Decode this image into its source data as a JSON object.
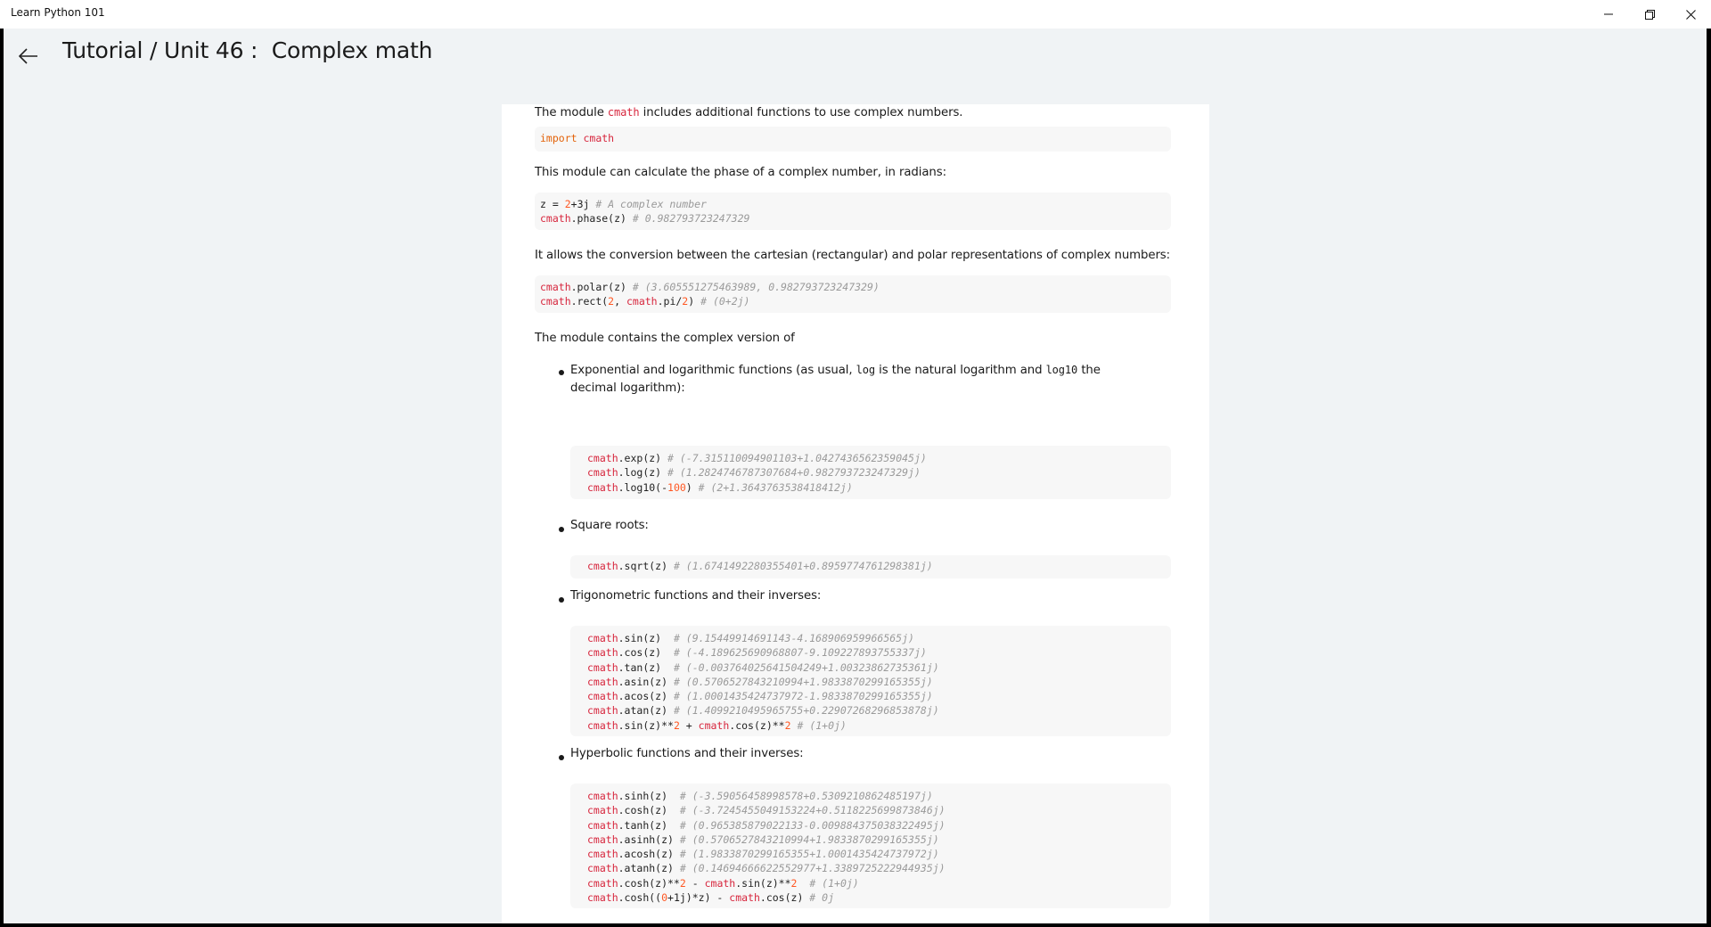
{
  "window": {
    "title": "Learn Python 101"
  },
  "header": {
    "title": "Tutorial / Unit 46 :  Complex math"
  },
  "colors": {
    "keyword": "#e36209",
    "module": "#d7263d",
    "number": "#ff5722",
    "comment": "#9a9a9a",
    "app_background": "#f0f3f5"
  },
  "content": {
    "intro": {
      "before": "The module ",
      "code": "cmath",
      "after": " includes additional functions to use complex numbers."
    },
    "phase_text": "This module can calculate the phase of a complex number, in radians:",
    "polar_text": "It allows the conversion between the cartesian (rectangular) and polar representations of complex numbers:",
    "contains_text": "The module contains the complex version of",
    "bullet_exp": {
      "t1": "Exponential and logarithmic functions (as usual, ",
      "c1": "log",
      "t2": " is the natural logarithm and ",
      "c2": "log10",
      "t3": " the decimal logarithm):"
    },
    "bullet_sqrt": "Square roots:",
    "bullet_trig": "Trigonometric functions and their inverses:",
    "bullet_hyp": "Hyperbolic functions and their inverses:"
  },
  "code_blocks": [
    [
      [
        [
          "kw",
          "import"
        ],
        [
          "tx",
          " "
        ],
        [
          "mod",
          "cmath"
        ]
      ]
    ],
    [
      [
        [
          "tx",
          "z = "
        ],
        [
          "num",
          "2"
        ],
        [
          "tx",
          "+3j "
        ],
        [
          "cm",
          "# A complex number"
        ]
      ],
      [
        [
          "mod",
          "cmath"
        ],
        [
          "tx",
          ".phase(z) "
        ],
        [
          "cm",
          "# 0.982793723247329"
        ]
      ]
    ],
    [
      [
        [
          "mod",
          "cmath"
        ],
        [
          "tx",
          ".polar(z) "
        ],
        [
          "cm",
          "# (3.605551275463989, 0.982793723247329)"
        ]
      ],
      [
        [
          "mod",
          "cmath"
        ],
        [
          "tx",
          ".rect("
        ],
        [
          "num",
          "2"
        ],
        [
          "tx",
          ", "
        ],
        [
          "mod",
          "cmath"
        ],
        [
          "tx",
          ".pi/"
        ],
        [
          "num",
          "2"
        ],
        [
          "tx",
          ") "
        ],
        [
          "cm",
          "# (0+2j)"
        ]
      ]
    ],
    [
      [
        [
          "mod",
          "cmath"
        ],
        [
          "tx",
          ".exp(z) "
        ],
        [
          "cm",
          "# (-7.315110094901103+1.0427436562359045j)"
        ]
      ],
      [
        [
          "mod",
          "cmath"
        ],
        [
          "tx",
          ".log(z) "
        ],
        [
          "cm",
          "# (1.2824746787307684+0.982793723247329j)"
        ]
      ],
      [
        [
          "mod",
          "cmath"
        ],
        [
          "tx",
          ".log10(-"
        ],
        [
          "num",
          "100"
        ],
        [
          "tx",
          ") "
        ],
        [
          "cm",
          "# (2+1.3643763538418412j)"
        ]
      ]
    ],
    [
      [
        [
          "mod",
          "cmath"
        ],
        [
          "tx",
          ".sqrt(z) "
        ],
        [
          "cm",
          "# (1.6741492280355401+0.8959774761298381j)"
        ]
      ]
    ],
    [
      [
        [
          "mod",
          "cmath"
        ],
        [
          "tx",
          ".sin(z)  "
        ],
        [
          "cm",
          "# (9.15449914691143-4.168906959966565j)"
        ]
      ],
      [
        [
          "mod",
          "cmath"
        ],
        [
          "tx",
          ".cos(z)  "
        ],
        [
          "cm",
          "# (-4.189625690968807-9.109227893755337j)"
        ]
      ],
      [
        [
          "mod",
          "cmath"
        ],
        [
          "tx",
          ".tan(z)  "
        ],
        [
          "cm",
          "# (-0.003764025641504249+1.00323862735361j)"
        ]
      ],
      [
        [
          "mod",
          "cmath"
        ],
        [
          "tx",
          ".asin(z) "
        ],
        [
          "cm",
          "# (0.5706527843210994+1.9833870299165355j)"
        ]
      ],
      [
        [
          "mod",
          "cmath"
        ],
        [
          "tx",
          ".acos(z) "
        ],
        [
          "cm",
          "# (1.0001435424737972-1.9833870299165355j)"
        ]
      ],
      [
        [
          "mod",
          "cmath"
        ],
        [
          "tx",
          ".atan(z) "
        ],
        [
          "cm",
          "# (1.4099210495965755+0.22907268296853878j)"
        ]
      ],
      [
        [
          "mod",
          "cmath"
        ],
        [
          "tx",
          ".sin(z)**"
        ],
        [
          "num",
          "2"
        ],
        [
          "tx",
          " + "
        ],
        [
          "mod",
          "cmath"
        ],
        [
          "tx",
          ".cos(z)**"
        ],
        [
          "num",
          "2"
        ],
        [
          "tx",
          " "
        ],
        [
          "cm",
          "# (1+0j)"
        ]
      ]
    ],
    [
      [
        [
          "mod",
          "cmath"
        ],
        [
          "tx",
          ".sinh(z)  "
        ],
        [
          "cm",
          "# (-3.59056458998578+0.5309210862485197j)"
        ]
      ],
      [
        [
          "mod",
          "cmath"
        ],
        [
          "tx",
          ".cosh(z)  "
        ],
        [
          "cm",
          "# (-3.7245455049153224+0.5118225699873846j)"
        ]
      ],
      [
        [
          "mod",
          "cmath"
        ],
        [
          "tx",
          ".tanh(z)  "
        ],
        [
          "cm",
          "# (0.965385879022133-0.009884375038322495j)"
        ]
      ],
      [
        [
          "mod",
          "cmath"
        ],
        [
          "tx",
          ".asinh(z) "
        ],
        [
          "cm",
          "# (0.5706527843210994+1.9833870299165355j)"
        ]
      ],
      [
        [
          "mod",
          "cmath"
        ],
        [
          "tx",
          ".acosh(z) "
        ],
        [
          "cm",
          "# (1.9833870299165355+1.0001435424737972j)"
        ]
      ],
      [
        [
          "mod",
          "cmath"
        ],
        [
          "tx",
          ".atanh(z) "
        ],
        [
          "cm",
          "# (0.14694666622552977+1.3389725222944935j)"
        ]
      ],
      [
        [
          "mod",
          "cmath"
        ],
        [
          "tx",
          ".cosh(z)**"
        ],
        [
          "num",
          "2"
        ],
        [
          "tx",
          " - "
        ],
        [
          "mod",
          "cmath"
        ],
        [
          "tx",
          ".sin(z)**"
        ],
        [
          "num",
          "2"
        ],
        [
          "tx",
          "  "
        ],
        [
          "cm",
          "# (1+0j)"
        ]
      ],
      [
        [
          "mod",
          "cmath"
        ],
        [
          "tx",
          ".cosh(("
        ],
        [
          "num",
          "0"
        ],
        [
          "tx",
          "+1j)*z) - "
        ],
        [
          "mod",
          "cmath"
        ],
        [
          "tx",
          ".cos(z) "
        ],
        [
          "cm",
          "# 0j"
        ]
      ]
    ]
  ]
}
